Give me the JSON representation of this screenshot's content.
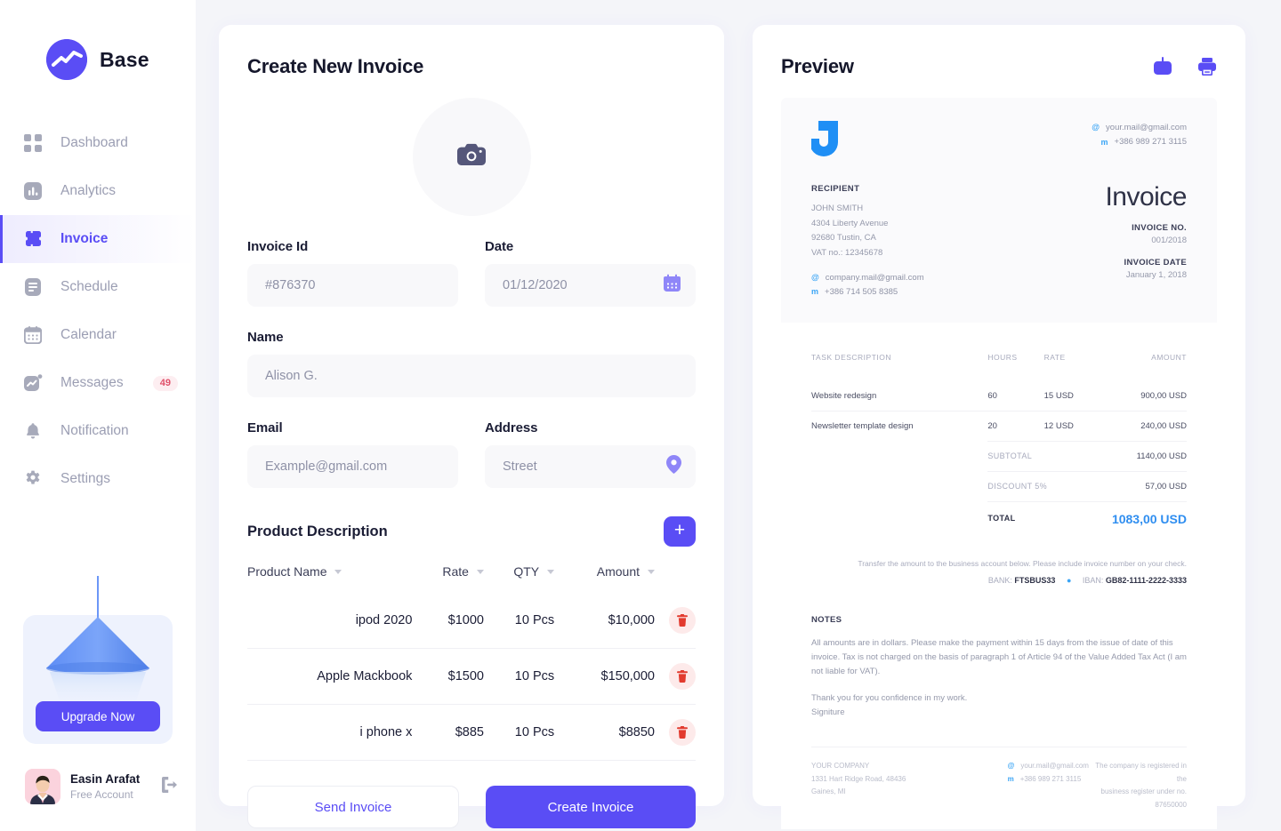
{
  "brand": {
    "name": "Base",
    "logo_icon": "chart-line-circle-logo"
  },
  "sidebar": {
    "items": [
      {
        "label": "Dashboard",
        "icon": "grid-icon",
        "active": false
      },
      {
        "label": "Analytics",
        "icon": "bar-chart-icon",
        "active": false
      },
      {
        "label": "Invoice",
        "icon": "ticket-icon",
        "active": true
      },
      {
        "label": "Schedule",
        "icon": "list-document-icon",
        "active": false
      },
      {
        "label": "Calendar",
        "icon": "calendar-icon",
        "active": false
      },
      {
        "label": "Messages",
        "icon": "chat-activity-icon",
        "active": false,
        "badge": "49"
      },
      {
        "label": "Notification",
        "icon": "bell-icon",
        "active": false
      },
      {
        "label": "Settings",
        "icon": "gear-icon",
        "active": false
      }
    ],
    "upgrade": {
      "button_label": "Upgrade Now",
      "illustration": "lamp-icon"
    },
    "profile": {
      "name": "Easin Arafat",
      "account_type": "Free Account",
      "avatar": "user-photo",
      "logout_icon": "logout-icon"
    }
  },
  "form": {
    "title": "Create New Invoice",
    "upload": {
      "icon": "camera-icon"
    },
    "fields": {
      "invoice_id": {
        "label": "Invoice Id",
        "value": "#876370"
      },
      "date": {
        "label": "Date",
        "value": "01/12/2020",
        "icon": "calendar-icon"
      },
      "name": {
        "label": "Name",
        "value": "Alison G."
      },
      "email": {
        "label": "Email",
        "placeholder": "Example@gmail.com"
      },
      "address": {
        "label": "Address",
        "placeholder": "Street",
        "icon": "location-pin-icon"
      }
    },
    "products": {
      "title": "Product Description",
      "add_label": "+",
      "columns": [
        "Product Name",
        "Rate",
        "QTY",
        "Amount"
      ],
      "rows": [
        {
          "name": "ipod 2020",
          "rate": "$1000",
          "qty": "10 Pcs",
          "amount": "$10,000"
        },
        {
          "name": "Apple Mackbook",
          "rate": "$1500",
          "qty": "10 Pcs",
          "amount": "$150,000"
        },
        {
          "name": "i phone x",
          "rate": "$885",
          "qty": "10 Pcs",
          "amount": "$8850"
        }
      ],
      "delete_icon": "trash-icon"
    },
    "buttons": {
      "send": "Send Invoice",
      "create": "Create Invoice"
    }
  },
  "preview": {
    "title": "Preview",
    "download_icon": "download-icon",
    "print_icon": "print-icon",
    "document": {
      "logo_letter": "J",
      "sender_contact": {
        "email": "your.mail@gmail.com",
        "phone": "+386 989 271 3115",
        "email_mark": "@",
        "phone_mark": "m"
      },
      "recipient_label": "RECIPIENT",
      "recipient": [
        "JOHN SMITH",
        "4304 Liberty Avenue",
        "92680 Tustin, CA",
        "VAT no.: 12345678"
      ],
      "recipient_contact": {
        "email": "company.mail@gmail.com",
        "phone": "+386 714 505 8385",
        "email_mark": "@",
        "phone_mark": "m"
      },
      "heading": "Invoice",
      "invoice_no_label": "INVOICE NO.",
      "invoice_no": "001/2018",
      "invoice_date_label": "INVOICE DATE",
      "invoice_date": "January 1, 2018",
      "table": {
        "columns": [
          "TASK DESCRIPTION",
          "HOURS",
          "RATE",
          "AMOUNT"
        ],
        "rows": [
          {
            "task": "Website redesign",
            "hours": "60",
            "rate": "15 USD",
            "amount": "900,00 USD"
          },
          {
            "task": "Newsletter template design",
            "hours": "20",
            "rate": "12 USD",
            "amount": "240,00 USD"
          }
        ],
        "summary": [
          {
            "label": "SUBTOTAL",
            "value": "1140,00 USD"
          },
          {
            "label": "DISCOUNT 5%",
            "value": "57,00 USD"
          },
          {
            "label": "TOTAL",
            "value": "1083,00 USD"
          }
        ]
      },
      "transfer_note": "Transfer the amount to the business account below. Please include invoice number on your check.",
      "bank_label": "BANK:",
      "bank_value": "FTSBUS33",
      "iban_label": "IBAN:",
      "iban_value": "GB82-1111-2222-3333",
      "notes_label": "NOTES",
      "notes_paragraph": "All amounts are in dollars. Please make the payment within 15 days from the issue of date of this invoice. Tax is not charged on the basis of paragraph 1 of Article 94 of the Value Added Tax Act (I am not liable for VAT).",
      "notes_thanks": "Thank you for you confidence in my work.",
      "notes_signature": "Signiture",
      "footer": {
        "company_label": "YOUR COMPANY",
        "company_address": "1331 Hart Ridge Road, 48436 Gaines, MI",
        "email": "your.mail@gmail.com",
        "phone": "+386 989 271 3115",
        "email_mark": "@",
        "phone_mark": "m",
        "registration_line1": "The company is registered in the",
        "registration_line2": "business register under no. 87650000"
      }
    }
  },
  "colors": {
    "accent": "#5a4df5",
    "link_blue": "#3c6fe0",
    "amount_green": "#22b14c",
    "doc_blue": "#2f8ef0",
    "badge_red": "#e0526b"
  }
}
